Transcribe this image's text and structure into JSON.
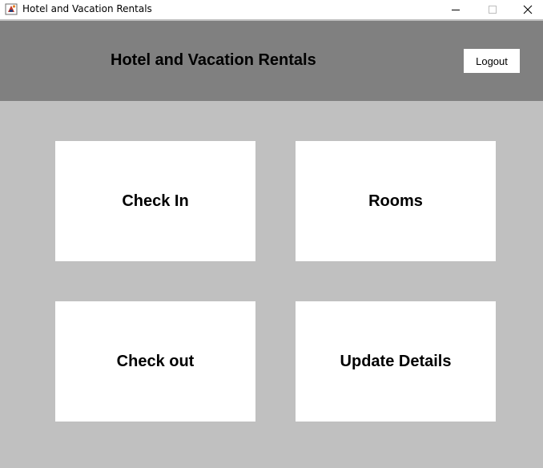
{
  "window": {
    "title": "Hotel and Vacation Rentals",
    "icon": "java-app-icon",
    "controls": [
      "minimize-icon",
      "maximize-icon",
      "close-icon"
    ]
  },
  "header": {
    "title": "Hotel and Vacation Rentals",
    "logout_label": "Logout",
    "background": "#808080"
  },
  "tiles": [
    {
      "label": "Check In"
    },
    {
      "label": "Rooms"
    },
    {
      "label": "Check out"
    },
    {
      "label": "Update Details"
    }
  ],
  "colors": {
    "page_background": "#c0c0c0",
    "tile_background": "#ffffff"
  }
}
